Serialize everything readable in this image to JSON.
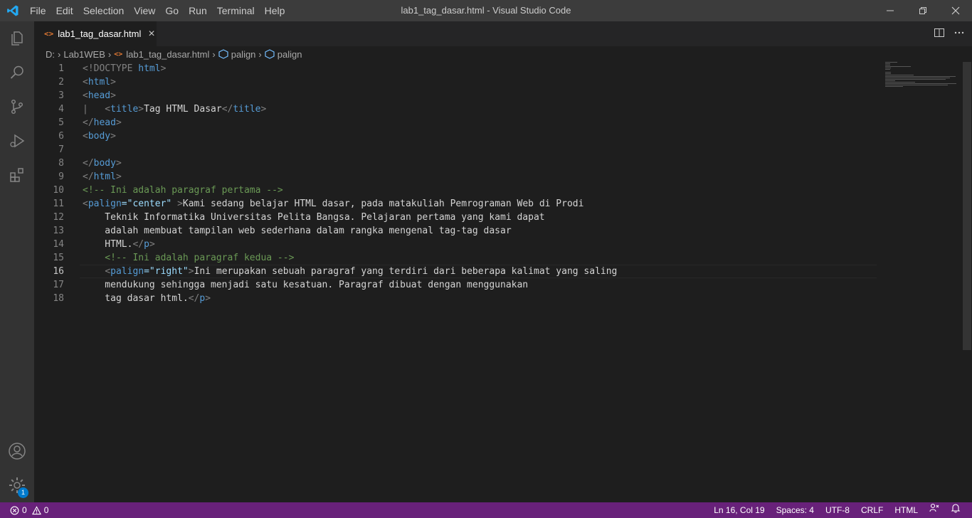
{
  "titlebar": {
    "menu": [
      "File",
      "Edit",
      "Selection",
      "View",
      "Go",
      "Run",
      "Terminal",
      "Help"
    ],
    "window_title": "lab1_tag_dasar.html - Visual Studio Code",
    "brand_color": "#23a9f2"
  },
  "activitybar": {
    "items": [
      "explorer-icon",
      "search-icon",
      "source-control-icon",
      "run-debug-icon",
      "extensions-icon"
    ],
    "bottom": [
      "account-icon",
      "settings-gear-icon"
    ],
    "settings_badge": "1"
  },
  "tabs": [
    {
      "label": "lab1_tag_dasar.html",
      "icon": "html-file-icon",
      "active": true
    }
  ],
  "breadcrumb": {
    "drive": "D:",
    "folder": "Lab1WEB",
    "file": "lab1_tag_dasar.html",
    "symbols": [
      "palign",
      "palign"
    ]
  },
  "editor": {
    "active_line": 16,
    "lines": [
      {
        "n": "1",
        "tokens": [
          {
            "t": "tag",
            "v": "<!DOCTYPE "
          },
          {
            "t": "name",
            "v": "html"
          },
          {
            "t": "tag",
            "v": ">"
          }
        ]
      },
      {
        "n": "2",
        "tokens": [
          {
            "t": "tag",
            "v": "<"
          },
          {
            "t": "name",
            "v": "html"
          },
          {
            "t": "tag",
            "v": ">"
          }
        ]
      },
      {
        "n": "3",
        "tokens": [
          {
            "t": "tag",
            "v": "<"
          },
          {
            "t": "name",
            "v": "head"
          },
          {
            "t": "tag",
            "v": ">"
          }
        ]
      },
      {
        "n": "4",
        "tokens": [
          {
            "t": "tag",
            "v": "|   <"
          },
          {
            "t": "name",
            "v": "title"
          },
          {
            "t": "tag",
            "v": ">"
          },
          {
            "t": "text",
            "v": "Tag HTML Dasar"
          },
          {
            "t": "tag",
            "v": "</"
          },
          {
            "t": "name",
            "v": "title"
          },
          {
            "t": "tag",
            "v": ">"
          }
        ]
      },
      {
        "n": "5",
        "tokens": [
          {
            "t": "tag",
            "v": "</"
          },
          {
            "t": "name",
            "v": "head"
          },
          {
            "t": "tag",
            "v": ">"
          }
        ]
      },
      {
        "n": "6",
        "tokens": [
          {
            "t": "tag",
            "v": "<"
          },
          {
            "t": "name",
            "v": "body"
          },
          {
            "t": "tag",
            "v": ">"
          }
        ]
      },
      {
        "n": "7",
        "tokens": []
      },
      {
        "n": "8",
        "tokens": [
          {
            "t": "tag",
            "v": "</"
          },
          {
            "t": "name",
            "v": "body"
          },
          {
            "t": "tag",
            "v": ">"
          }
        ]
      },
      {
        "n": "9",
        "tokens": [
          {
            "t": "tag",
            "v": "</"
          },
          {
            "t": "name",
            "v": "html"
          },
          {
            "t": "tag",
            "v": ">"
          }
        ]
      },
      {
        "n": "10",
        "tokens": [
          {
            "t": "comment",
            "v": "<!-- Ini adalah paragraf pertama -->"
          }
        ]
      },
      {
        "n": "11",
        "tokens": [
          {
            "t": "tag",
            "v": "<"
          },
          {
            "t": "name",
            "v": "palign"
          },
          {
            "t": "val",
            "v": "=\"center\""
          },
          {
            "t": "tag",
            "v": " >"
          },
          {
            "t": "text",
            "v": "Kami sedang belajar HTML dasar, pada matakuliah Pemrograman Web di Prodi"
          }
        ]
      },
      {
        "n": "12",
        "tokens": [
          {
            "t": "text",
            "v": "    Teknik Informatika Universitas Pelita Bangsa. Pelajaran pertama yang kami dapat"
          }
        ]
      },
      {
        "n": "13",
        "tokens": [
          {
            "t": "text",
            "v": "    adalah membuat tampilan web sederhana dalam rangka mengenal tag-tag dasar"
          }
        ]
      },
      {
        "n": "14",
        "tokens": [
          {
            "t": "text",
            "v": "    HTML."
          },
          {
            "t": "tag",
            "v": "</"
          },
          {
            "t": "name",
            "v": "p"
          },
          {
            "t": "tag",
            "v": ">"
          }
        ]
      },
      {
        "n": "15",
        "tokens": [
          {
            "t": "comment",
            "v": "    <!-- Ini adalah paragraf kedua -->"
          }
        ]
      },
      {
        "n": "16",
        "tokens": [
          {
            "t": "text",
            "v": "    "
          },
          {
            "t": "tag",
            "v": "<"
          },
          {
            "t": "name",
            "v": "palign"
          },
          {
            "t": "val",
            "v": "=\"right\""
          },
          {
            "t": "tag",
            "v": ">"
          },
          {
            "t": "text",
            "v": "Ini merupakan sebuah paragraf yang terdiri dari beberapa kalimat yang saling"
          }
        ]
      },
      {
        "n": "17",
        "tokens": [
          {
            "t": "text",
            "v": "    mendukung sehingga menjadi satu kesatuan. Paragraf dibuat dengan menggunakan"
          }
        ]
      },
      {
        "n": "18",
        "tokens": [
          {
            "t": "text",
            "v": "    tag dasar html."
          },
          {
            "t": "tag",
            "v": "</"
          },
          {
            "t": "name",
            "v": "p"
          },
          {
            "t": "tag",
            "v": ">"
          }
        ]
      }
    ]
  },
  "statusbar": {
    "errors": "0",
    "warnings": "0",
    "position": "Ln 16, Col 19",
    "spaces": "Spaces: 4",
    "encoding": "UTF-8",
    "eol": "CRLF",
    "language": "HTML",
    "bg_color": "#68217a"
  }
}
